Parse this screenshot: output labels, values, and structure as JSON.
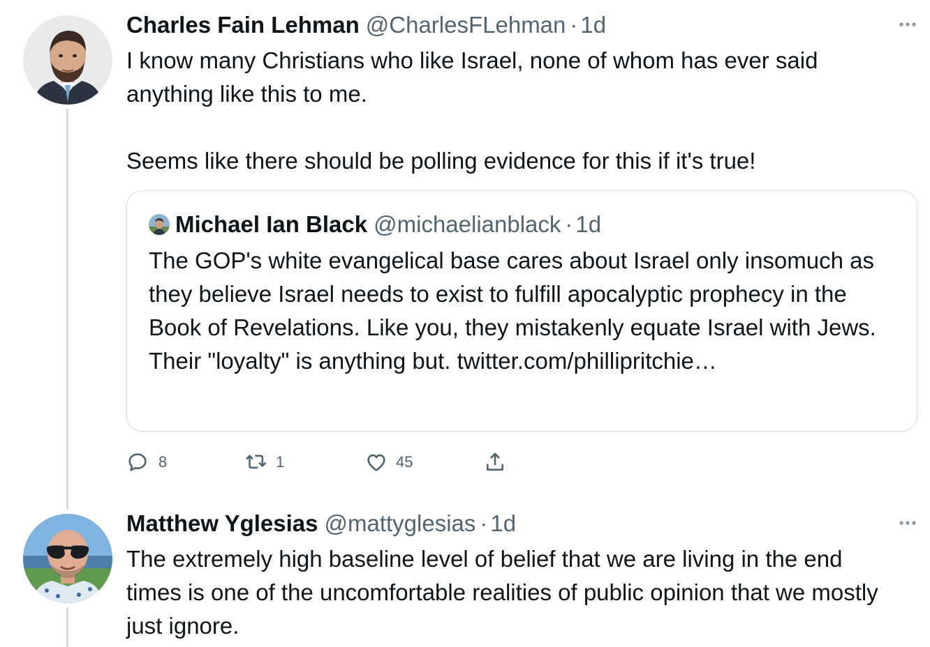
{
  "tweets": [
    {
      "author_name": "Charles Fain Lehman",
      "handle": "@CharlesFLehman",
      "separator": "·",
      "time": "1d",
      "text": "I know many Christians who like Israel, none of whom has ever said anything like this to me.\n\nSeems like there should be polling evidence for this if it's true!",
      "avatar_icon": "avatar-man-beard-suit",
      "quote": {
        "author_name": "Michael Ian Black",
        "handle": "@michaelianblack",
        "separator": "·",
        "time": "1d",
        "text": "The GOP's white evangelical base cares about Israel only insomuch as they believe Israel needs to exist to fulfill apocalyptic prophecy in the Book of Revelations. Like you, they mistakenly equate Israel with Jews. Their \"loyalty\" is anything but. twitter.com/phillipritchie…"
      },
      "actions": {
        "reply_count": "8",
        "retweet_count": "1",
        "like_count": "45",
        "icons": [
          "reply-icon",
          "retweet-icon",
          "like-icon",
          "share-icon"
        ]
      }
    },
    {
      "author_name": "Matthew Yglesias",
      "handle": "@mattyglesias",
      "separator": "·",
      "time": "1d",
      "text": "The extremely high baseline level of belief that we are living in the end times is one of the uncomfortable realities of public opinion that we mostly just ignore.",
      "avatar_icon": "avatar-man-sunglasses"
    }
  ],
  "colors": {
    "text_primary": "#0f1419",
    "text_secondary": "#536471",
    "border": "#cfd9de"
  }
}
